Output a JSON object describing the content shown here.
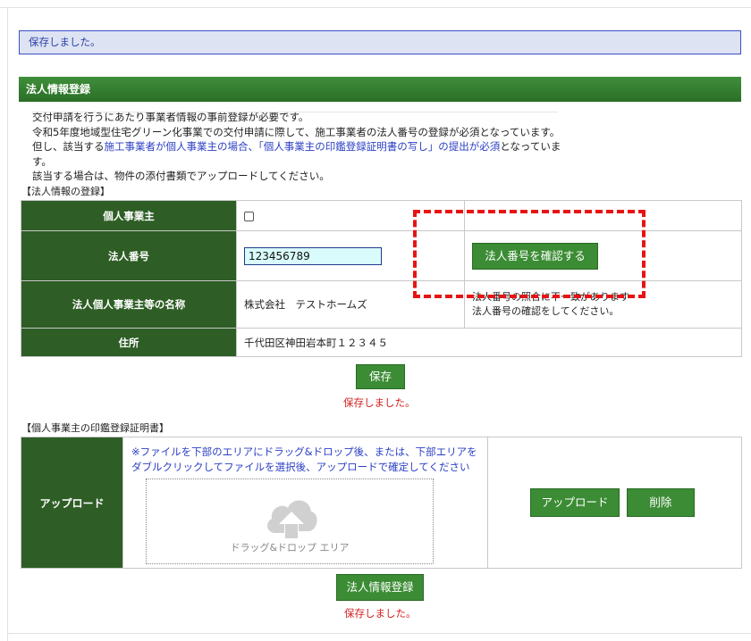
{
  "notice": {
    "saved_message": "保存しました。"
  },
  "section": {
    "title": "法人情報登録"
  },
  "notes": {
    "line1": "交付申請を行うにあたり事業者情報の事前登録が必要です。",
    "line2": "令和5年度地域型住宅グリーン化事業での交付申請に際して、施工事業者の法人番号の登録が必須となっています。",
    "line3_prefix": "但し、該当する",
    "line3_blue": "施工事業者が個人事業主の場合、「個人事業主の印鑑登録証明書の写し」の提出が必須",
    "line3_suffix": "となっています。",
    "line4": "該当する場合は、物件の添付書類でアップロードしてください。"
  },
  "corp_form": {
    "heading": "【法人情報の登録】",
    "rows": {
      "sole_proprietor": {
        "label": "個人事業主"
      },
      "corp_number": {
        "label": "法人番号",
        "value": "123456789",
        "confirm_button": "法人番号を確認する"
      },
      "corp_name": {
        "label": "法人個人事業主等の名称",
        "value": "株式会社　テストホームズ",
        "message_line1": "法人番号の照合に不一致があります",
        "message_line2": "法人番号の確認をしてください。"
      },
      "address": {
        "label": "住所",
        "value": "千代田区神田岩本町１２３４５"
      }
    },
    "save_button": "保存",
    "save_status": "保存しました。"
  },
  "seal_cert": {
    "heading": "【個人事業主の印鑑登録証明書】",
    "row_label": "アップロード",
    "instruction": "※ファイルを下部のエリアにドラッグ&ドロップ後、または、下部エリアをダブルクリックしてファイルを選択後、アップロードで確定してください",
    "drop_label": "ドラッグ&ドロップ エリア",
    "upload_button": "アップロード",
    "delete_button": "削除"
  },
  "footer": {
    "register_button": "法人情報登録",
    "status": "保存しました。"
  },
  "colors": {
    "header_green": "#2e5e25",
    "button_green": "#3b8c34",
    "notice_bg": "#dde3f2",
    "highlight_red": "#e81313",
    "status_red": "#d12020"
  }
}
